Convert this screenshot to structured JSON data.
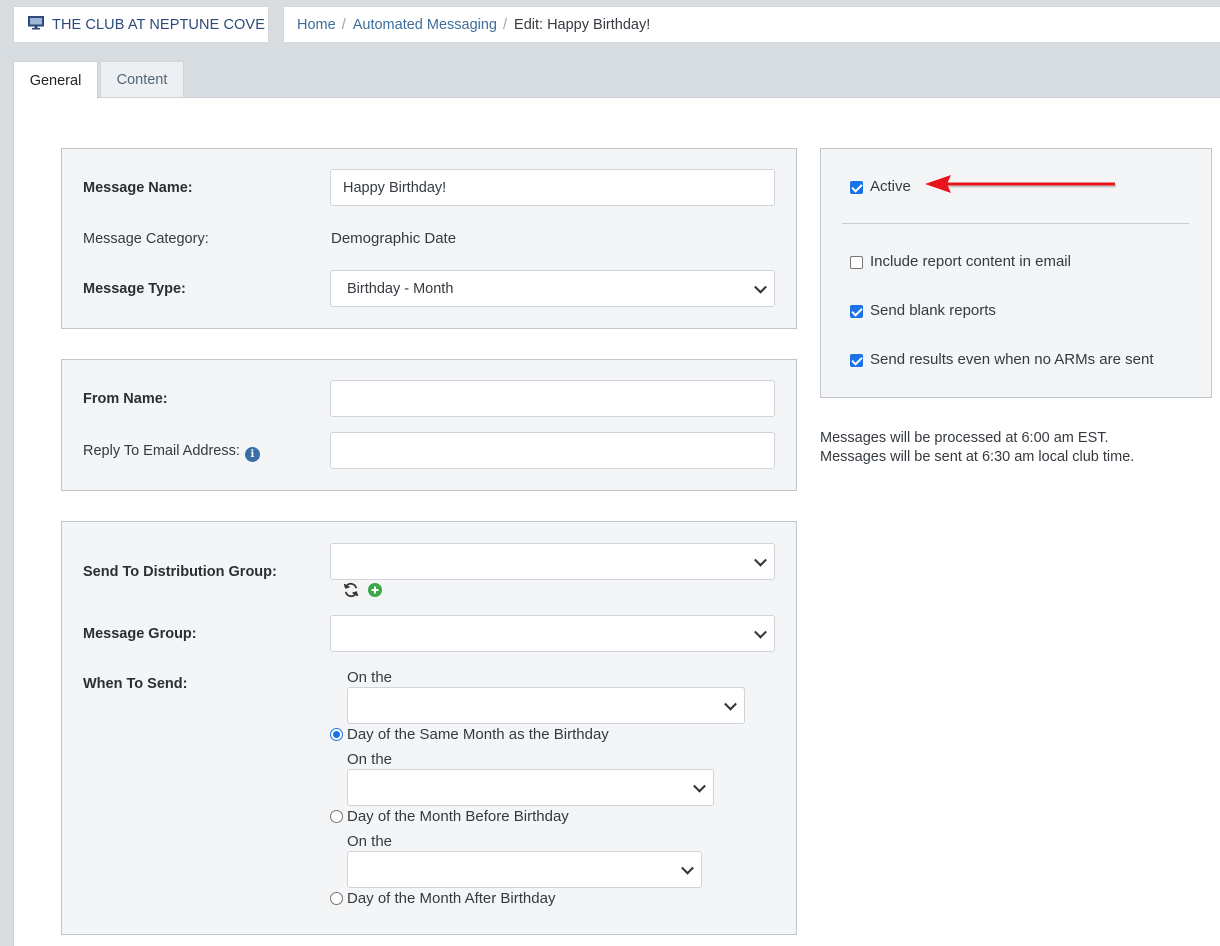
{
  "header": {
    "club_name": "THE CLUB AT NEPTUNE COVE",
    "club_icon": "monitor-icon",
    "breadcrumb": {
      "home": "Home",
      "section": "Automated Messaging",
      "current": "Edit: Happy Birthday!",
      "separator": "/"
    }
  },
  "tabs": [
    {
      "label": "General",
      "active": true
    },
    {
      "label": "Content",
      "active": false
    }
  ],
  "message_card": {
    "name_label": "Message Name:",
    "name_value": "Happy Birthday!",
    "category_label": "Message Category:",
    "category_value": "Demographic Date",
    "type_label": "Message Type:",
    "type_value": "Birthday - Month"
  },
  "sender_card": {
    "from_label": "From Name:",
    "from_value": "",
    "reply_label": "Reply To Email Address:",
    "reply_value": "",
    "info_icon": "info-icon"
  },
  "distribution_card": {
    "group_label": "Send To Distribution Group:",
    "group_value": "",
    "refresh_icon": "refresh-icon",
    "add_icon": "add-circle-icon",
    "message_group_label": "Message Group:",
    "message_group_value": "",
    "when_label": "When To Send:",
    "on_the": "On the",
    "options": [
      {
        "label": "Day of the Same Month as the Birthday",
        "checked": true,
        "select_value": ""
      },
      {
        "label": "Day of the Month Before Birthday",
        "checked": false,
        "select_value": ""
      },
      {
        "label": "Day of the Month After Birthday",
        "checked": false,
        "select_value": ""
      }
    ]
  },
  "settings_card": {
    "active_label": "Active",
    "active_checked": true,
    "include_report_label": "Include report content in email",
    "include_report_checked": false,
    "send_blank_label": "Send blank reports",
    "send_blank_checked": true,
    "send_results_label": "Send results even when no ARMs are sent",
    "send_results_checked": true,
    "annotation_arrow_color": "#e8141b"
  },
  "notes": {
    "processed": "Messages will be processed at 6:00 am EST.",
    "sent": "Messages will be sent at 6:30 am local club time."
  },
  "colors": {
    "page_bg": "#d7dce1",
    "card_bg": "#f4f5f7",
    "link": "#3d6e9c",
    "accent": "#1a73e8",
    "add_green": "#3aa845"
  }
}
